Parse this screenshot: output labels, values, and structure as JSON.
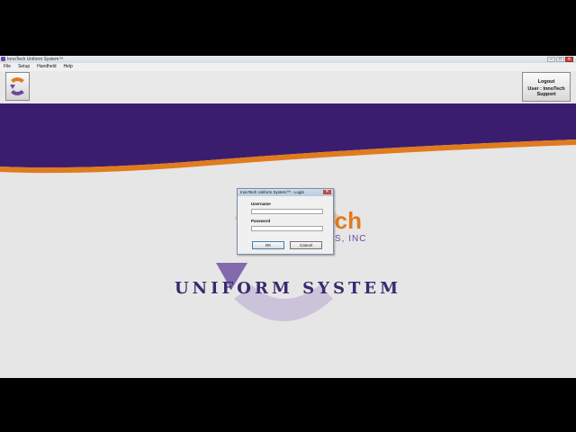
{
  "window": {
    "title": "InnoTech Uniform System™",
    "controls": {
      "minimize": "–",
      "maximize": "□",
      "close": "✕"
    }
  },
  "menu": {
    "items": [
      "File",
      "Setup",
      "Handheld",
      "Help"
    ]
  },
  "toolbar": {
    "home_icon": "innotech-logo-icon",
    "logout_label": "Logout",
    "user_label": "User : InnoTech Support"
  },
  "background": {
    "company_name": "...ch",
    "company_suffix": "S, INC",
    "product_title": "UNIFORM SYSTEM",
    "colors": {
      "purple": "#3a1d6e",
      "orange": "#e07b1e"
    }
  },
  "login_dialog": {
    "title": "InnoTech Uniform System™ - Login",
    "close_label": "✕",
    "username_label": "Username",
    "username_value": "",
    "password_label": "Password",
    "password_value": "",
    "ok_label": "OK",
    "cancel_label": "Cancel"
  }
}
